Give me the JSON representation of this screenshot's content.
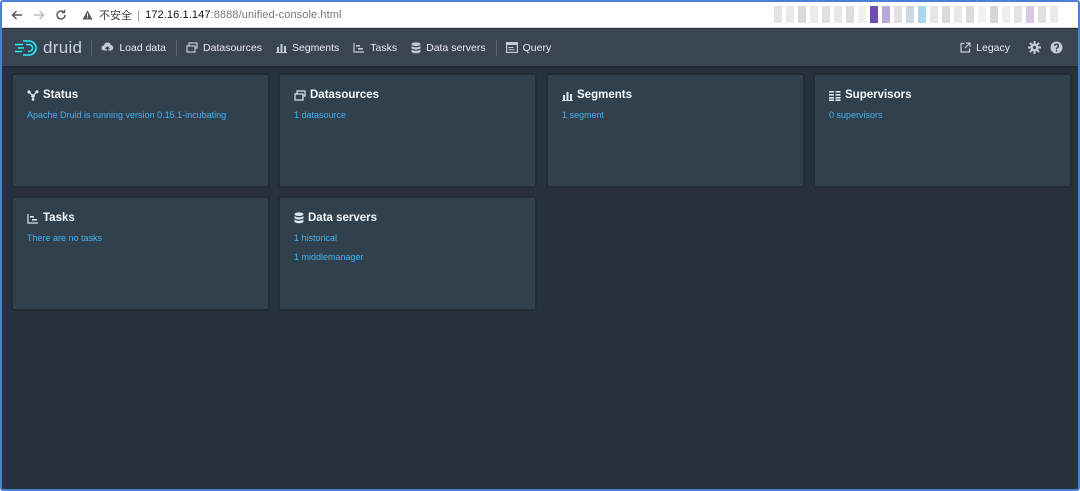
{
  "browser": {
    "insecure_label": "不安全",
    "url_host": "172.16.1.147",
    "url_rest": ":8888/unified-console.html"
  },
  "nav": {
    "logo_text": "druid",
    "items": [
      {
        "label": "Load data",
        "icon": "cloud-upload-icon"
      },
      {
        "label": "Datasources",
        "icon": "multi-select-icon"
      },
      {
        "label": "Segments",
        "icon": "stacked-chart-icon"
      },
      {
        "label": "Tasks",
        "icon": "gantt-chart-icon"
      },
      {
        "label": "Data servers",
        "icon": "database-icon"
      },
      {
        "label": "Query",
        "icon": "application-icon"
      }
    ],
    "legacy_label": "Legacy"
  },
  "cards": [
    {
      "title": "Status",
      "icon": "graph-icon",
      "lines": [
        "Apache Druid is running version 0.15.1-incubating"
      ]
    },
    {
      "title": "Datasources",
      "icon": "multi-select-icon",
      "lines": [
        "1 datasource"
      ]
    },
    {
      "title": "Segments",
      "icon": "stacked-chart-icon",
      "lines": [
        "1 segment"
      ]
    },
    {
      "title": "Supervisors",
      "icon": "list-columns-icon",
      "lines": [
        "0 supervisors"
      ]
    },
    {
      "title": "Tasks",
      "icon": "gantt-chart-icon",
      "lines": [
        "There are no tasks"
      ]
    },
    {
      "title": "Data servers",
      "icon": "database-icon",
      "lines": [
        "1 historical",
        "1 middlemanager"
      ]
    }
  ],
  "colors": {
    "background": "#28323c",
    "navbar": "#3a4552",
    "card": "#30404d",
    "link": "#48aff0"
  }
}
